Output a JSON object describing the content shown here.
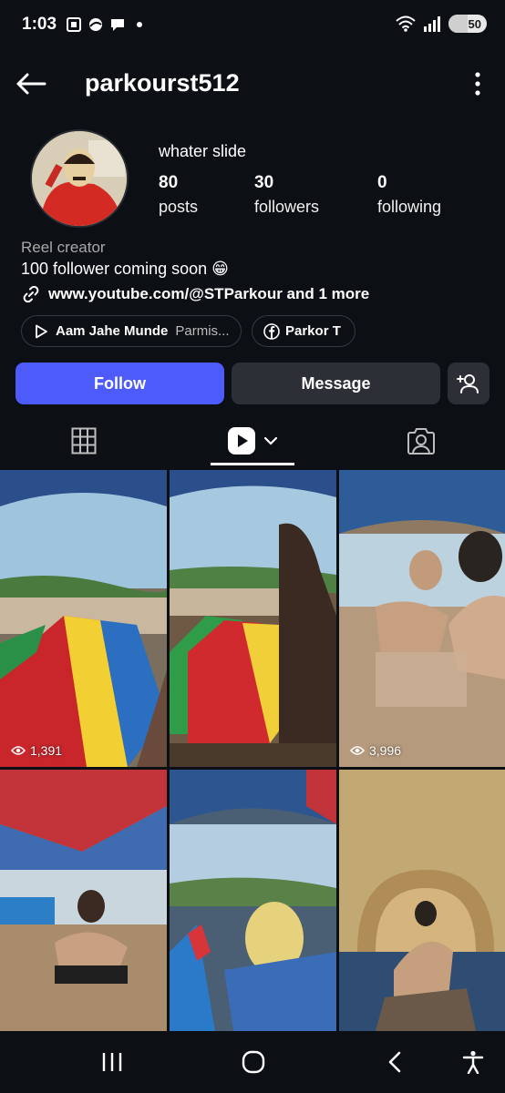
{
  "status_bar": {
    "time": "1:03",
    "battery": "50",
    "battery_level": 0.5
  },
  "header": {
    "username": "parkourst512"
  },
  "profile": {
    "display_name": "whater slide",
    "stats": [
      {
        "value": "80",
        "label": "posts"
      },
      {
        "value": "30",
        "label": "followers"
      },
      {
        "value": "0",
        "label": "following"
      }
    ],
    "category": "Reel creator",
    "bio": "100 follower coming soon 😁",
    "link": "www.youtube.com/@STParkour and 1 more",
    "chips": [
      {
        "title": "Aam Jahe Munde",
        "subtitle": "Parmis...",
        "icon": "play-icon"
      },
      {
        "title": "Parkor T",
        "icon": "facebook-icon"
      }
    ]
  },
  "actions": {
    "follow": "Follow",
    "message": "Message"
  },
  "tabs": [
    "grid-icon",
    "reels-icon",
    "tagged-icon"
  ],
  "posts": [
    {
      "views": "1,391"
    },
    {
      "views": ""
    },
    {
      "views": "3,996"
    },
    {
      "views": ""
    },
    {
      "views": ""
    },
    {
      "views": ""
    }
  ],
  "colors": {
    "background": "#0c0f14",
    "follow_button": "#4c5bfa",
    "secondary_button": "#2c2f36"
  }
}
